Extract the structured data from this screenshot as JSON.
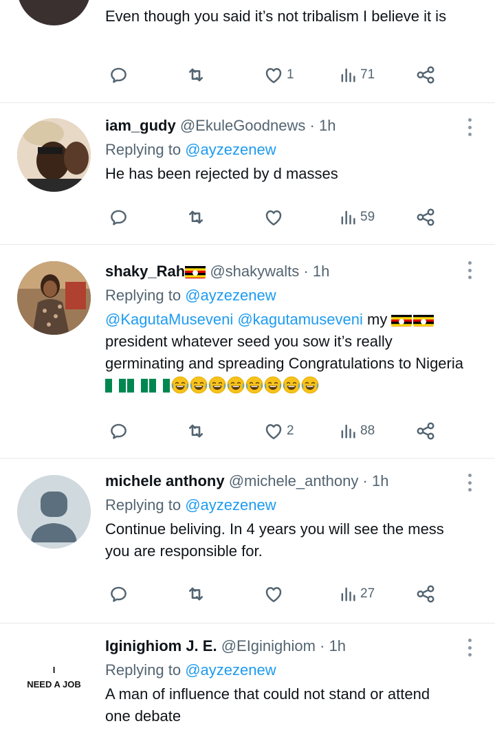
{
  "colors": {
    "link": "#1d9bf0",
    "muted": "#536471",
    "text": "#0f1419",
    "divider": "#e6e9ec"
  },
  "tweets": [
    {
      "text": "Even though you said it’s not tribalism I believe it is",
      "stats": {
        "likes": "1",
        "views": "71"
      }
    },
    {
      "name": "iam_gudy",
      "handle": "@EkuleGoodnews",
      "dot": "·",
      "time": "1h",
      "replying_prefix": "Replying to",
      "replying_to": "@ayzezenew",
      "text": "He has been rejected by d masses",
      "stats": {
        "likes": "",
        "views": "59"
      }
    },
    {
      "name": "shaky_Rah",
      "handle": "@shakywalts",
      "dot": "·",
      "time": "1h",
      "replying_prefix": "Replying to",
      "replying_to": "@ayzezenew",
      "mention1": "@KagutaMuseveni",
      "mention2": "@kagutamuseveni",
      "text_part1": "my",
      "text_part2": "president whatever seed you sow it’s really germinating and spreading Congratulations to Nigeria",
      "stats": {
        "likes": "2",
        "views": "88"
      }
    },
    {
      "name": "michele anthony",
      "handle": "@michele_anthony",
      "dot": "·",
      "time": "1h",
      "replying_prefix": "Replying to",
      "replying_to": "@ayzezenew",
      "text": "Continue beliving. In 4 years you will see the mess you are responsible for.",
      "stats": {
        "likes": "",
        "views": "27"
      }
    },
    {
      "name": "Iginighiom J. E.",
      "handle": "@EIginighiom",
      "dot": "·",
      "time": "1h",
      "avatar_text_line1": "I",
      "avatar_text_line2": "NEED A JOB",
      "replying_prefix": "Replying to",
      "replying_to": "@ayzezenew",
      "text": "A man of influence that could not stand or attend one debate"
    }
  ],
  "icons": [
    "reply-icon",
    "retweet-icon",
    "like-icon",
    "views-icon",
    "share-icon",
    "more-icon"
  ]
}
